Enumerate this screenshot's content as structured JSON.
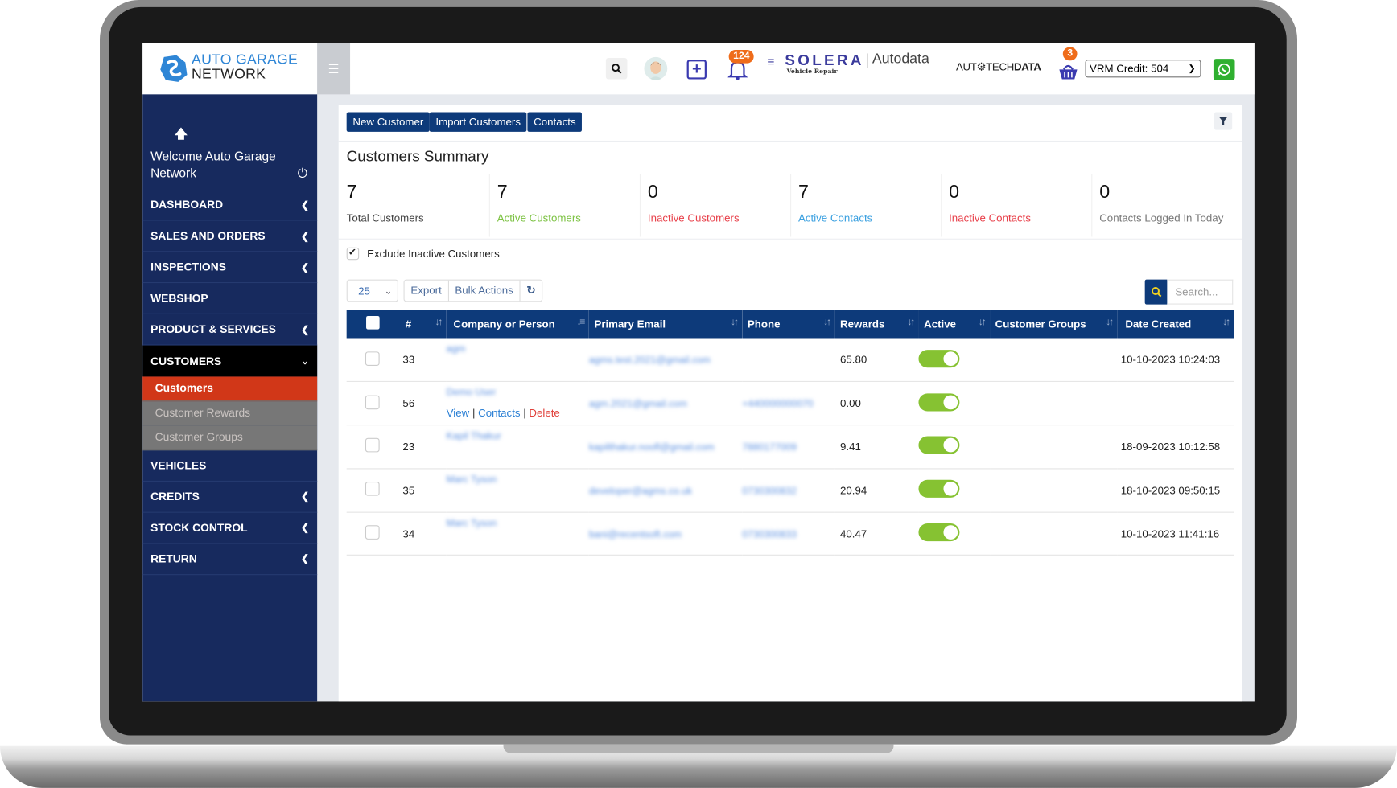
{
  "brand": {
    "line1": "AUTO GARAGE",
    "line2": "NETWORK",
    "accent": "#2f86d6",
    "sidebar_bg": "#172a5e",
    "primary": "#0d3a7a",
    "active_menu": "#d13718",
    "toggle_on": "#86c232"
  },
  "topbar": {
    "notifications_count": "124",
    "solera_name": "SOLERA",
    "solera_sub": "Vehicle Repair",
    "autodata": "Autodata",
    "autotechdata_a": "AUT",
    "autotechdata_b": "TECH",
    "autotechdata_c": "DATA",
    "basket_count": "3",
    "vrm_credit": "VRM Credit: 504",
    "icons": [
      "search-icon",
      "avatar",
      "plus-square-icon",
      "bell-icon",
      "basket-icon",
      "whatsapp-icon"
    ]
  },
  "sidebar": {
    "welcome": "Welcome Auto Garage Network",
    "items": [
      {
        "label": "DASHBOARD",
        "arrow": "‹"
      },
      {
        "label": "SALES AND ORDERS",
        "arrow": "‹"
      },
      {
        "label": "INSPECTIONS",
        "arrow": "‹"
      },
      {
        "label": "WEBSHOP",
        "arrow": ""
      },
      {
        "label": "PRODUCT & SERVICES",
        "arrow": "‹"
      },
      {
        "label": "CUSTOMERS",
        "arrow": "⌄"
      },
      {
        "label": "VEHICLES",
        "arrow": ""
      },
      {
        "label": "CREDITS",
        "arrow": "‹"
      },
      {
        "label": "STOCK CONTROL",
        "arrow": "‹"
      },
      {
        "label": "RETURN",
        "arrow": "‹"
      }
    ],
    "customers_sub": [
      {
        "label": "Customers",
        "active": true
      },
      {
        "label": "Customer Rewards",
        "active": false
      },
      {
        "label": "Customer Groups",
        "active": false
      }
    ]
  },
  "toolbar": {
    "new_customer": "New Customer",
    "import_customers": "Import Customers",
    "contacts": "Contacts"
  },
  "summary": {
    "title": "Customers Summary",
    "stats": [
      {
        "value": "7",
        "label": "Total Customers",
        "color": "#444444"
      },
      {
        "value": "7",
        "label": "Active Customers",
        "color": "#7cc242"
      },
      {
        "value": "0",
        "label": "Inactive Customers",
        "color": "#e8404a"
      },
      {
        "value": "7",
        "label": "Active Contacts",
        "color": "#3aa0e0"
      },
      {
        "value": "0",
        "label": "Inactive Contacts",
        "color": "#e8404a"
      },
      {
        "value": "0",
        "label": "Contacts Logged In Today",
        "color": "#777777"
      }
    ]
  },
  "filters": {
    "exclude_inactive_label": "Exclude Inactive Customers",
    "exclude_inactive_checked": true,
    "page_length": "25",
    "export": "Export",
    "bulk_actions": "Bulk Actions",
    "search_placeholder": "Search..."
  },
  "table": {
    "columns": [
      "#",
      "Company or Person",
      "Primary Email",
      "Phone",
      "Rewards",
      "Active",
      "Customer Groups",
      "Date Created"
    ],
    "row_actions": {
      "view": "View",
      "contacts": "Contacts",
      "delete": "Delete"
    },
    "rows": [
      {
        "id": "33",
        "name": "agm",
        "email": "agms.test.2021@gmail.com",
        "phone": "",
        "rewards": "65.80",
        "active": true,
        "groups": "",
        "date": "10-10-2023 10:24:03"
      },
      {
        "id": "56",
        "name": "Demo User",
        "email": "agm.2021@gmail.com",
        "phone": "+440000000070",
        "rewards": "0.00",
        "active": true,
        "groups": "",
        "date": "",
        "show_actions": true
      },
      {
        "id": "23",
        "name": "Kapil Thakur",
        "email": "kapilthakur.noofl@gmail.com",
        "phone": "7880177009",
        "rewards": "9.41",
        "active": true,
        "groups": "",
        "date": "18-09-2023 10:12:58"
      },
      {
        "id": "35",
        "name": "Marc Tyson",
        "email": "developer@agms.co.uk",
        "phone": "0730300832",
        "rewards": "20.94",
        "active": true,
        "groups": "",
        "date": "18-10-2023 09:50:15"
      },
      {
        "id": "34",
        "name": "Marc Tyson",
        "email": "bani@recentsoft.com",
        "phone": "0730300833",
        "rewards": "40.47",
        "active": true,
        "groups": "",
        "date": "10-10-2023 11:41:16"
      }
    ]
  }
}
